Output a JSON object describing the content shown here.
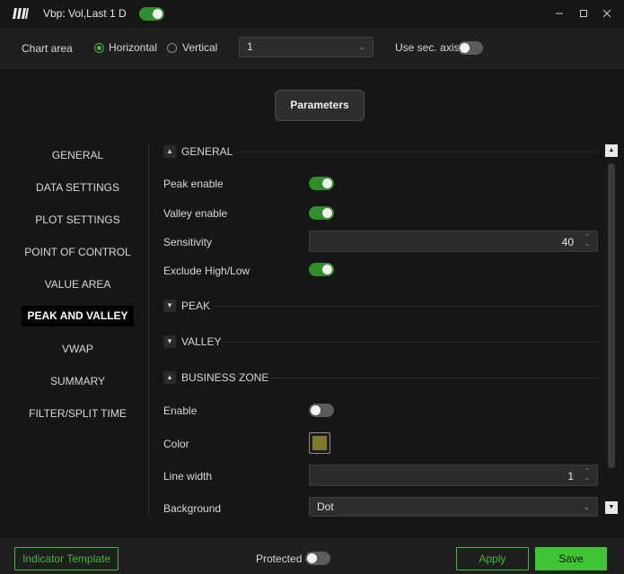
{
  "window": {
    "title": "Vbp: Vol,Last 1 D",
    "enabled": true,
    "icons": [
      "app-logo-icon",
      "minimize-icon",
      "maximize-icon",
      "close-icon"
    ]
  },
  "chart_area": {
    "label": "Chart area",
    "orientation_options": [
      "Horizontal",
      "Vertical"
    ],
    "selected_orientation": "Horizontal",
    "panel_select_value": "1",
    "use_sec_axis_label": "Use sec. axis",
    "use_sec_axis": false
  },
  "parameters_button": "Parameters",
  "nav": {
    "items": [
      "GENERAL",
      "DATA SETTINGS",
      "PLOT SETTINGS",
      "POINT OF CONTROL",
      "VALUE AREA",
      "PEAK AND VALLEY",
      "VWAP",
      "SUMMARY",
      "FILTER/SPLIT TIME"
    ],
    "active": "PEAK AND VALLEY"
  },
  "sections": {
    "general": {
      "title": "GENERAL",
      "expanded": true,
      "peak_enable_label": "Peak enable",
      "peak_enable": true,
      "valley_enable_label": "Valley enable",
      "valley_enable": true,
      "sensitivity_label": "Sensitivity",
      "sensitivity_value": "40",
      "exclude_label": "Exclude High/Low",
      "exclude": true
    },
    "peak": {
      "title": "PEAK",
      "expanded": false
    },
    "valley": {
      "title": "VALLEY",
      "expanded": false
    },
    "business_zone": {
      "title": "BUSINESS ZONE",
      "expanded": true,
      "enable_label": "Enable",
      "enable": false,
      "color_label": "Color",
      "color": "#7d7a2c",
      "line_width_label": "Line width",
      "line_width_value": "1",
      "background_label": "Background",
      "background_value": "Dot"
    }
  },
  "footer": {
    "template_button": "Indicator Template",
    "protected_label": "Protected",
    "protected": false,
    "apply_button": "Apply",
    "save_button": "Save"
  },
  "colors": {
    "accent": "#3fb836",
    "toggle_on": "#2f8f2a",
    "save_bg": "#3dc533"
  }
}
